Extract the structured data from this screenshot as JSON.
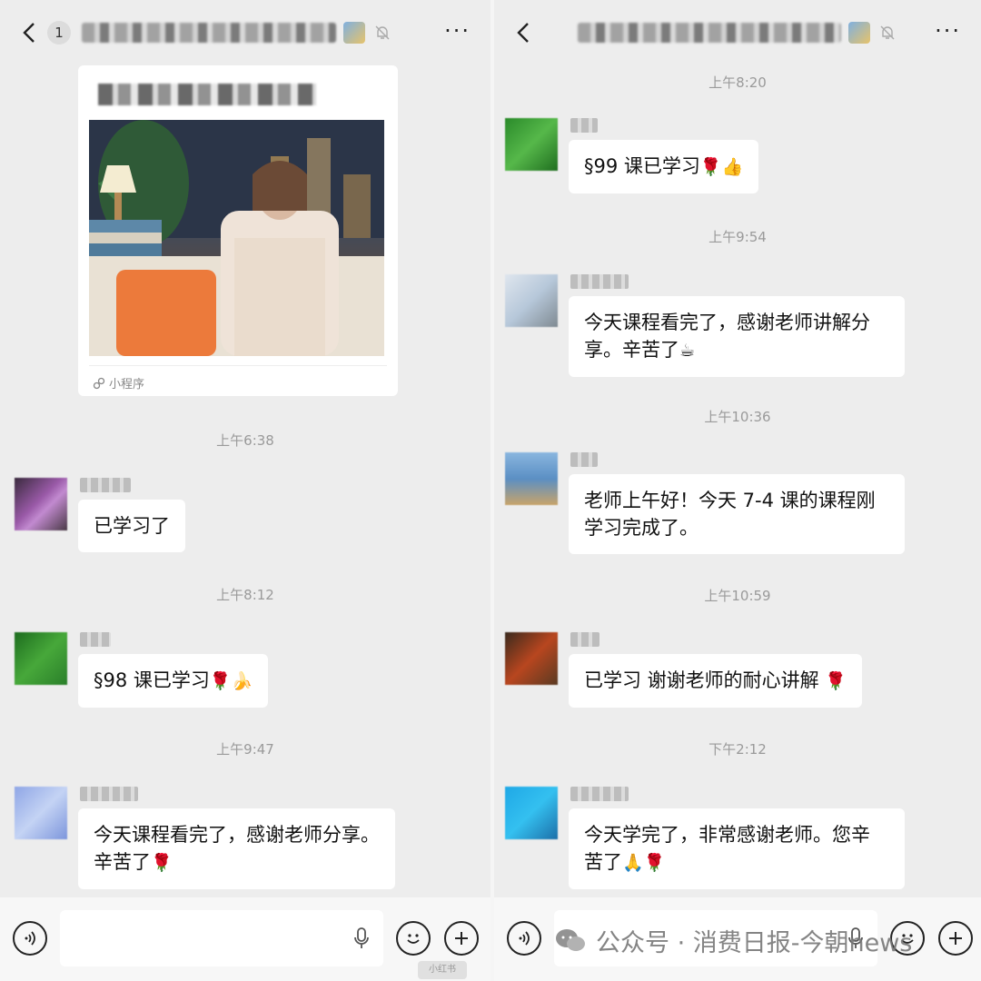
{
  "left": {
    "unread_count": "1",
    "card_footer": "小程序",
    "messages": [
      {
        "time": "上午6:38",
        "text": "已学习了",
        "emoji": ""
      },
      {
        "time": "上午8:12",
        "text": "§98 课已学习",
        "emoji": "🌹🍌"
      },
      {
        "time": "上午9:47",
        "text": "今天课程看完了，感谢老师分享。",
        "text2": "辛苦了",
        "emoji": "🌹"
      }
    ]
  },
  "right": {
    "messages": [
      {
        "time": "上午8:20",
        "text": "§99 课已学习",
        "emoji": "🌹👍"
      },
      {
        "time": "上午9:54",
        "text": "今天课程看完了，感谢老师讲解分",
        "text2": "享。辛苦了",
        "emoji": "☕"
      },
      {
        "time": "上午10:36",
        "text": "老师上午好！今天 7-4 课的课程刚",
        "text2": "学习完成了。"
      },
      {
        "time": "上午10:59",
        "text": "已学习 谢谢老师的耐心讲解",
        "emoji": "🌹"
      },
      {
        "time": "下午2:12",
        "text": "今天学完了，非常感谢老师。您辛",
        "text2": "苦了",
        "emoji": "🙏🌹"
      }
    ]
  },
  "watermark": "公众号 · 消费日报-今朝news",
  "tag": "小红书",
  "icons": [
    "back-icon",
    "mute-icon",
    "more-icon",
    "voice-icon",
    "mic-icon",
    "emoji-icon",
    "plus-icon",
    "mini-program-icon"
  ],
  "colors": {
    "background": "#ededed",
    "bubble": "#ffffff",
    "timestamp": "#9a9a9a"
  }
}
